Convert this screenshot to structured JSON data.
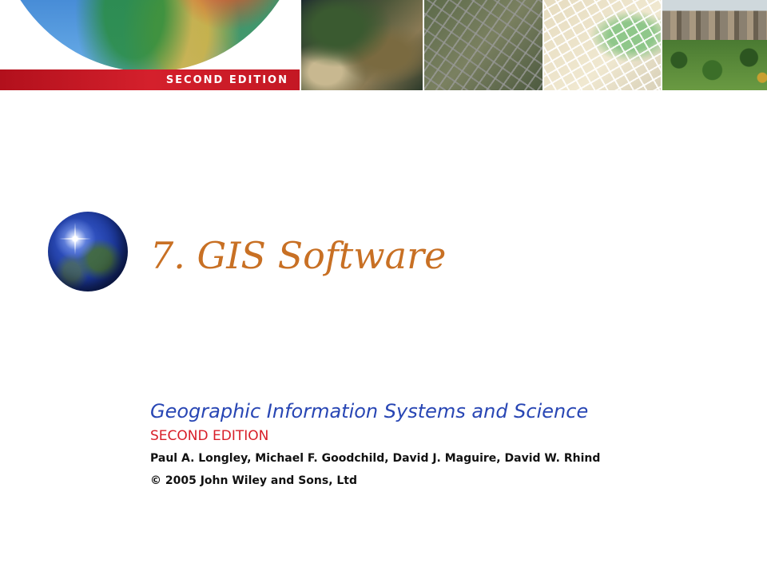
{
  "banner": {
    "edition_label": "SECOND EDITION",
    "panels": [
      "globe-image",
      "satellite-image",
      "city-aerial-image",
      "street-map-image",
      "3d-city-model-image"
    ]
  },
  "slide": {
    "title": "7. GIS Software",
    "globe_icon": "globe-icon"
  },
  "book": {
    "title": "Geographic Information Systems and Science",
    "edition": "SECOND EDITION",
    "authors": "Paul A. Longley, Michael F. Goodchild, David J. Maguire, David W. Rhind",
    "copyright": "© 2005 John Wiley and Sons, Ltd"
  },
  "colors": {
    "title": "#c87024",
    "book_title": "#2846b4",
    "edition": "#d81e28",
    "banner_red": "#c41824",
    "body_text": "#111111"
  }
}
